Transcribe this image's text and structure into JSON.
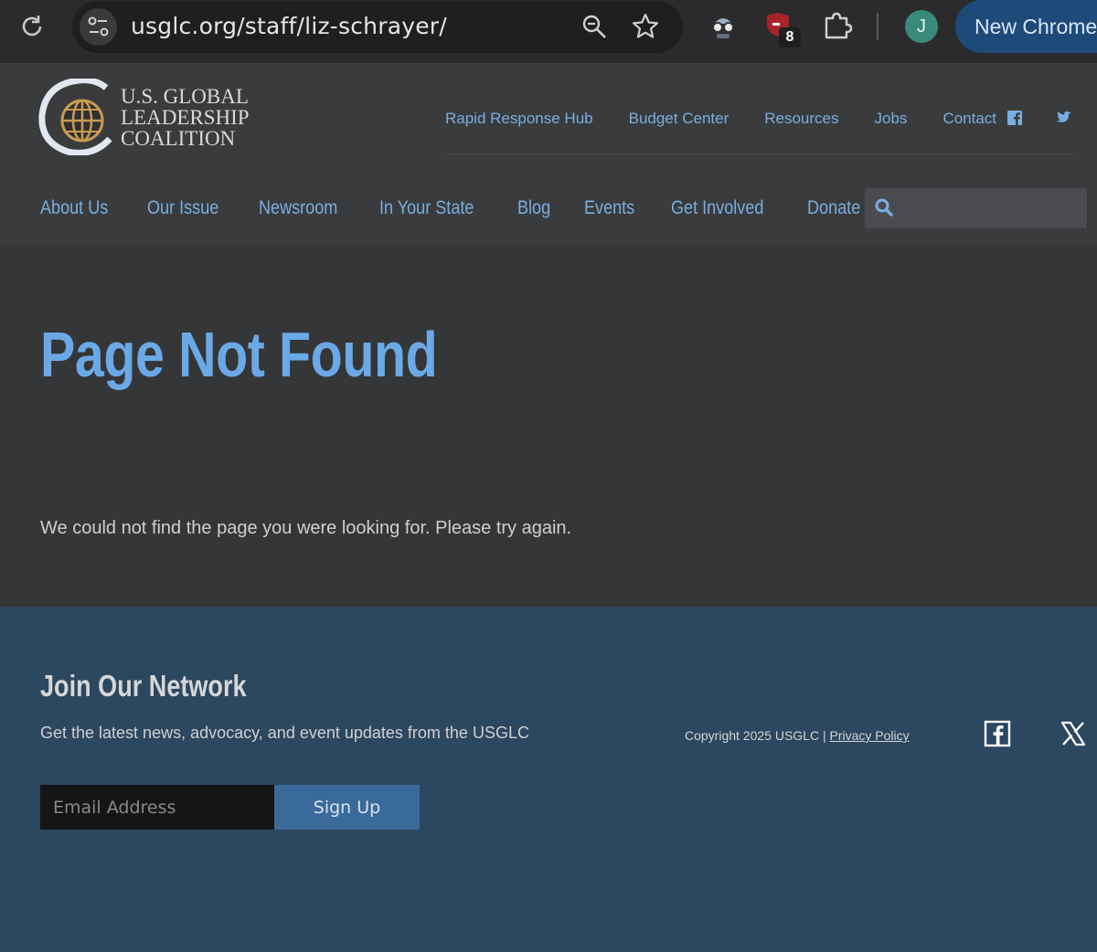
{
  "browser": {
    "url": "usglc.org/staff/liz-schrayer/",
    "extension_badge": "8",
    "avatar_letter": "J",
    "new_chrome_label": "New Chrome"
  },
  "logo": {
    "line1": "U.S. GLOBAL",
    "line2": "LEADERSHIP",
    "line3": "COALITION"
  },
  "util_nav": [
    "Rapid Response Hub",
    "Budget Center",
    "Resources",
    "Jobs",
    "Contact"
  ],
  "main_nav": [
    "About Us",
    "Our Issue",
    "Newsroom",
    "In Your State",
    "Blog",
    "Events",
    "Get Involved",
    "Donate"
  ],
  "content": {
    "title": "Page Not Found",
    "message": "We could not find the page you were looking for. Please try again."
  },
  "footer": {
    "join_title": "Join Our Network",
    "join_desc": "Get the latest news, advocacy, and event updates from the USGLC",
    "email_placeholder": "Email Address",
    "signup_label": "Sign Up",
    "copyright": "Copyright 2025 USGLC | ",
    "privacy_label": "Privacy Policy"
  },
  "colors": {
    "accent_blue": "#78aee0",
    "title_blue": "#6aa9e6",
    "footer_bg": "#2c4760",
    "button_blue": "#3a6a9a"
  },
  "icons": [
    "reload-icon",
    "tune-icon",
    "zoom-icon",
    "star-icon",
    "spy-extension-icon",
    "shield-extension-icon",
    "puzzle-icon",
    "facebook-icon",
    "twitter-icon",
    "search-icon",
    "x-icon"
  ]
}
